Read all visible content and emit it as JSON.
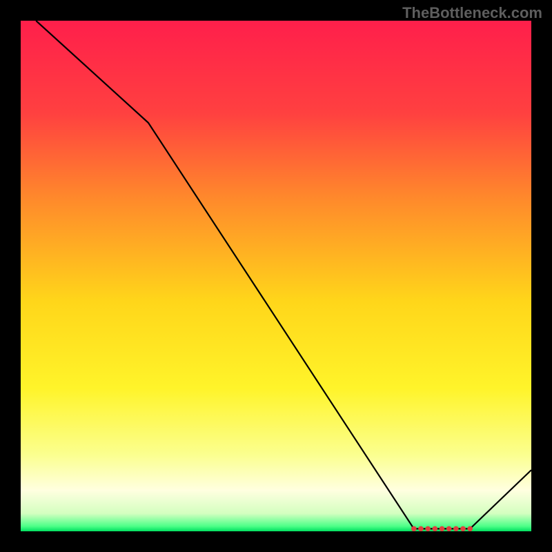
{
  "watermark": "TheBottleneck.com",
  "chart_data": {
    "type": "line",
    "title": "",
    "xlabel": "",
    "ylabel": "",
    "xlim": [
      0,
      100
    ],
    "ylim": [
      0,
      100
    ],
    "x": [
      3,
      25,
      77,
      88,
      100
    ],
    "values": [
      100,
      80,
      0.5,
      0.5,
      12
    ],
    "marker_region": {
      "x_start": 77,
      "x_end": 88,
      "y": 0.5,
      "count": 9,
      "color": "#e04040"
    },
    "gradient_stops": [
      {
        "offset": 0.0,
        "color": "#ff1f4b"
      },
      {
        "offset": 0.18,
        "color": "#ff4040"
      },
      {
        "offset": 0.35,
        "color": "#ff8a2b"
      },
      {
        "offset": 0.55,
        "color": "#ffd61a"
      },
      {
        "offset": 0.72,
        "color": "#fff42a"
      },
      {
        "offset": 0.85,
        "color": "#fbff8f"
      },
      {
        "offset": 0.92,
        "color": "#ffffe0"
      },
      {
        "offset": 0.965,
        "color": "#d4ffc0"
      },
      {
        "offset": 0.99,
        "color": "#4dff88"
      },
      {
        "offset": 1.0,
        "color": "#00e060"
      }
    ],
    "line_color": "#000000",
    "line_width": 2.2
  }
}
